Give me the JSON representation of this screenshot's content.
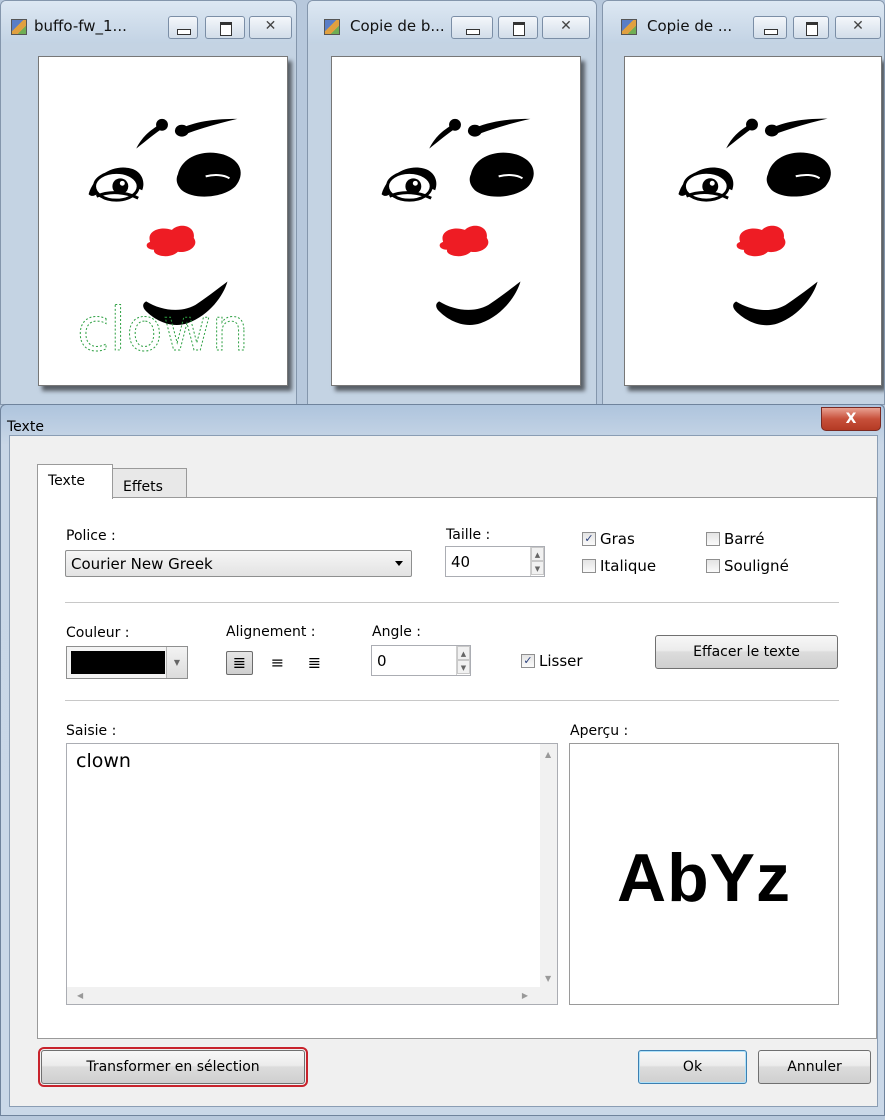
{
  "image_windows": [
    {
      "title": "buffo-fw_1...",
      "canvas_text": "clown"
    },
    {
      "title": "Copie de b..."
    },
    {
      "title": "Copie de ..."
    }
  ],
  "dialog": {
    "title": "Texte",
    "tabs": [
      "Texte",
      "Effets"
    ],
    "police": {
      "label": "Police :",
      "value": "Courier New Greek"
    },
    "taille": {
      "label": "Taille :",
      "value": "40"
    },
    "style_options": {
      "gras": {
        "label": "Gras",
        "checked": true
      },
      "italique": {
        "label": "Italique",
        "checked": false
      },
      "barre": {
        "label": "Barré",
        "checked": false
      },
      "souligne": {
        "label": "Souligné",
        "checked": false
      }
    },
    "couleur": {
      "label": "Couleur :",
      "value": "#000000"
    },
    "alignement": {
      "label": "Alignement :",
      "selected": "left",
      "options": [
        "left",
        "center",
        "right"
      ]
    },
    "angle": {
      "label": "Angle :",
      "value": "0"
    },
    "lisser": {
      "label": "Lisser",
      "checked": true
    },
    "effacer_button": "Effacer le texte",
    "saisie": {
      "label": "Saisie :",
      "value": "clown"
    },
    "apercu": {
      "label": "Aperçu :",
      "sample": "AbYz"
    },
    "buttons": {
      "transformer": "Transformer en sélection",
      "ok": "Ok",
      "annuler": "Annuler"
    }
  },
  "colors": {
    "nose_red": "#ee1c24",
    "outline_green": "#2ea043",
    "highlight_border": "#c8232c",
    "close_red": "#c7503a"
  }
}
